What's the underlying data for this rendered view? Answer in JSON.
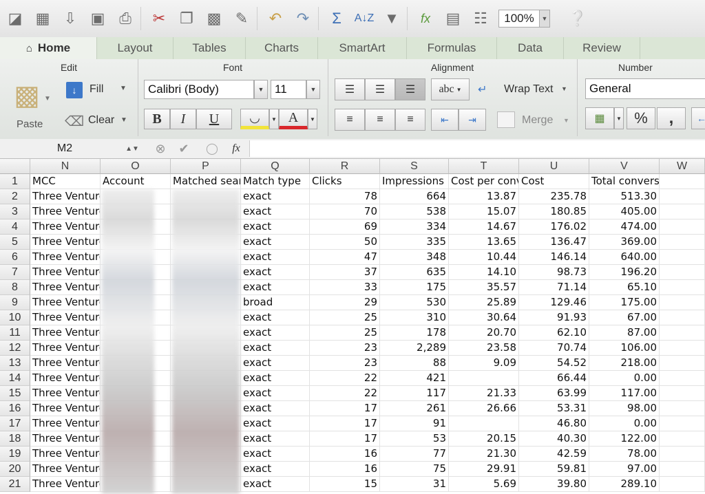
{
  "toolbar": {
    "zoom": "100%"
  },
  "tabs": [
    {
      "label": "Home",
      "active": true
    },
    {
      "label": "Layout"
    },
    {
      "label": "Tables"
    },
    {
      "label": "Charts"
    },
    {
      "label": "SmartArt"
    },
    {
      "label": "Formulas"
    },
    {
      "label": "Data"
    },
    {
      "label": "Review"
    }
  ],
  "ribbon": {
    "edit_title": "Edit",
    "paste_label": "Paste",
    "fill_label": "Fill",
    "clear_label": "Clear",
    "font_title": "Font",
    "font_name": "Calibri (Body)",
    "font_size": "11",
    "bold": "B",
    "italic": "I",
    "underline": "U",
    "font_color_letter": "A",
    "alignment_title": "Alignment",
    "abc_label": "abc",
    "wrap_text_label": "Wrap Text",
    "merge_label": "Merge",
    "number_title": "Number",
    "number_format": "General",
    "percent_label": "%",
    "comma_label": ","
  },
  "formula_bar": {
    "name_box": "M2",
    "fx_label": "fx",
    "formula": ""
  },
  "columns": [
    "N",
    "O",
    "P",
    "Q",
    "R",
    "S",
    "T",
    "U",
    "V",
    "W"
  ],
  "headers": [
    "MCC",
    "Account",
    "Matched sear",
    "Match type",
    "Clicks",
    "Impressions",
    "Cost per conv",
    "Cost",
    "Total conversion value",
    ""
  ],
  "rows": [
    {
      "n": "2",
      "mcc": "Three Venture",
      "match": "exact",
      "clicks": "78",
      "impr": "664",
      "cpc": "13.87",
      "cost": "235.78",
      "tcv": "513.30"
    },
    {
      "n": "3",
      "mcc": "Three Venture",
      "match": "exact",
      "clicks": "70",
      "impr": "538",
      "cpc": "15.07",
      "cost": "180.85",
      "tcv": "405.00"
    },
    {
      "n": "4",
      "mcc": "Three Venture",
      "match": "exact",
      "clicks": "69",
      "impr": "334",
      "cpc": "14.67",
      "cost": "176.02",
      "tcv": "474.00"
    },
    {
      "n": "5",
      "mcc": "Three Venture",
      "match": "exact",
      "clicks": "50",
      "impr": "335",
      "cpc": "13.65",
      "cost": "136.47",
      "tcv": "369.00"
    },
    {
      "n": "6",
      "mcc": "Three Venture",
      "match": "exact",
      "clicks": "47",
      "impr": "348",
      "cpc": "10.44",
      "cost": "146.14",
      "tcv": "640.00"
    },
    {
      "n": "7",
      "mcc": "Three Venture",
      "match": "exact",
      "clicks": "37",
      "impr": "635",
      "cpc": "14.10",
      "cost": "98.73",
      "tcv": "196.20"
    },
    {
      "n": "8",
      "mcc": "Three Venture",
      "match": "exact",
      "clicks": "33",
      "impr": "175",
      "cpc": "35.57",
      "cost": "71.14",
      "tcv": "65.10"
    },
    {
      "n": "9",
      "mcc": "Three Venture",
      "match": "broad",
      "clicks": "29",
      "impr": "530",
      "cpc": "25.89",
      "cost": "129.46",
      "tcv": "175.00"
    },
    {
      "n": "10",
      "mcc": "Three Venture",
      "match": "exact",
      "clicks": "25",
      "impr": "310",
      "cpc": "30.64",
      "cost": "91.93",
      "tcv": "67.00"
    },
    {
      "n": "11",
      "mcc": "Three Venture",
      "match": "exact",
      "clicks": "25",
      "impr": "178",
      "cpc": "20.70",
      "cost": "62.10",
      "tcv": "87.00"
    },
    {
      "n": "12",
      "mcc": "Three Venture",
      "match": "exact",
      "clicks": "23",
      "impr": "2,289",
      "cpc": "23.58",
      "cost": "70.74",
      "tcv": "106.00"
    },
    {
      "n": "13",
      "mcc": "Three Venture",
      "match": "exact",
      "clicks": "23",
      "impr": "88",
      "cpc": "9.09",
      "cost": "54.52",
      "tcv": "218.00"
    },
    {
      "n": "14",
      "mcc": "Three Venture",
      "match": "exact",
      "clicks": "22",
      "impr": "421",
      "cpc": "",
      "cost": "66.44",
      "tcv": "0.00"
    },
    {
      "n": "15",
      "mcc": "Three Venture",
      "match": "exact",
      "clicks": "22",
      "impr": "117",
      "cpc": "21.33",
      "cost": "63.99",
      "tcv": "117.00"
    },
    {
      "n": "16",
      "mcc": "Three Venture",
      "match": "exact",
      "clicks": "17",
      "impr": "261",
      "cpc": "26.66",
      "cost": "53.31",
      "tcv": "98.00"
    },
    {
      "n": "17",
      "mcc": "Three Venture",
      "match": "exact",
      "clicks": "17",
      "impr": "91",
      "cpc": "",
      "cost": "46.80",
      "tcv": "0.00"
    },
    {
      "n": "18",
      "mcc": "Three Venture",
      "match": "exact",
      "clicks": "17",
      "impr": "53",
      "cpc": "20.15",
      "cost": "40.30",
      "tcv": "122.00"
    },
    {
      "n": "19",
      "mcc": "Three Venture",
      "match": "exact",
      "clicks": "16",
      "impr": "77",
      "cpc": "21.30",
      "cost": "42.59",
      "tcv": "78.00"
    },
    {
      "n": "20",
      "mcc": "Three Venture",
      "match": "exact",
      "clicks": "16",
      "impr": "75",
      "cpc": "29.91",
      "cost": "59.81",
      "tcv": "97.00"
    },
    {
      "n": "21",
      "mcc": "Three Venture",
      "match": "exact",
      "clicks": "15",
      "impr": "31",
      "cpc": "5.69",
      "cost": "39.80",
      "tcv": "289.10"
    }
  ]
}
